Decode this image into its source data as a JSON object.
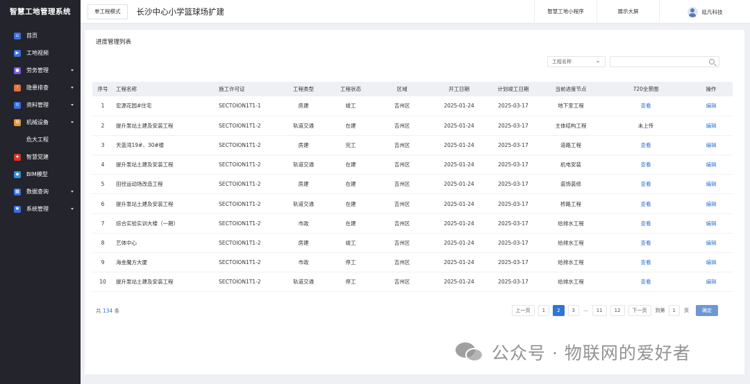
{
  "app": {
    "title": "智慧工地管理系统"
  },
  "sidebar": {
    "items": [
      {
        "label": "首页",
        "icon": "home-icon",
        "color": "#3b6fe0",
        "glyph": "⌂",
        "caret": false
      },
      {
        "label": "工地视频",
        "icon": "video-icon",
        "color": "#3b6fe0",
        "glyph": "▶",
        "caret": false
      },
      {
        "label": "劳务管理",
        "icon": "labor-icon",
        "color": "#7b5ce0",
        "glyph": "●",
        "caret": true
      },
      {
        "label": "隐患排查",
        "icon": "hazard-icon",
        "color": "#e0733b",
        "glyph": "!",
        "caret": true
      },
      {
        "label": "资料管理",
        "icon": "document-icon",
        "color": "#3b6fe0",
        "glyph": "≡",
        "caret": true
      },
      {
        "label": "机械设备",
        "icon": "machine-icon",
        "color": "#e09a3b",
        "glyph": "⚙",
        "caret": true
      },
      {
        "label": "危大工程",
        "icon": "",
        "color": "",
        "glyph": "",
        "caret": false,
        "sub": true
      },
      {
        "label": "智慧党建",
        "icon": "party-icon",
        "color": "#d9342b",
        "glyph": "★",
        "caret": false
      },
      {
        "label": "BIM模型",
        "icon": "bim-icon",
        "color": "#2f8fe0",
        "glyph": "◆",
        "caret": false
      },
      {
        "label": "数据查询",
        "icon": "data-icon",
        "color": "#3b6fe0",
        "glyph": "▦",
        "caret": true
      },
      {
        "label": "系统管理",
        "icon": "system-icon",
        "color": "#3b6fe0",
        "glyph": "✱",
        "caret": true
      }
    ]
  },
  "header": {
    "mode_button": "单工程模式",
    "project_title": "长沙中心小学篮球场扩建",
    "links": [
      "智慧工地小程序",
      "展示大屏"
    ],
    "user": "延凡科技"
  },
  "main": {
    "title": "进度管理列表",
    "filter": {
      "select_placeholder": "工程名称",
      "search_value": ""
    },
    "columns": [
      "序号",
      "工程名称",
      "施工许可证",
      "工程类型",
      "工程状态",
      "区域",
      "开工日期",
      "计划竣工日期",
      "当前进度节点",
      "720全景图",
      "操作"
    ],
    "rows": [
      {
        "no": "1",
        "name": "宏源花园#住宅",
        "permit": "SECTOION1T1-1",
        "type": "房建",
        "status": "竣工",
        "region": "吉州区",
        "start": "2025-01-24",
        "end": "2025-03-17",
        "node": "地下室工程",
        "pano": "查看",
        "pano_link": true,
        "action": "编辑"
      },
      {
        "no": "2",
        "name": "提升泵站土建及安装工程",
        "permit": "SECTOION1T1-2",
        "type": "轨道交通",
        "status": "在建",
        "region": "吉州区",
        "start": "2025-01-24",
        "end": "2025-03-17",
        "node": "主体结构工程",
        "pano": "未上传",
        "pano_link": false,
        "action": "编辑"
      },
      {
        "no": "3",
        "name": "天蓝湾19#、30#楼",
        "permit": "SECTOION1T1-2",
        "type": "房建",
        "status": "完工",
        "region": "吉州区",
        "start": "2025-01-24",
        "end": "2025-03-17",
        "node": "道路工程",
        "pano": "查看",
        "pano_link": true,
        "action": "编辑"
      },
      {
        "no": "4",
        "name": "提升泵站土建及安装工程",
        "permit": "SECTOION1T1-2",
        "type": "轨道交通",
        "status": "在建",
        "region": "吉州区",
        "start": "2025-01-24",
        "end": "2025-03-17",
        "node": "机电安装",
        "pano": "查看",
        "pano_link": true,
        "action": "编辑"
      },
      {
        "no": "5",
        "name": "田径运动场改造工程",
        "permit": "SECTOION1T1-2",
        "type": "房建",
        "status": "在建",
        "region": "吉州区",
        "start": "2025-01-24",
        "end": "2025-03-17",
        "node": "装饰装修",
        "pano": "查看",
        "pano_link": true,
        "action": "编辑"
      },
      {
        "no": "6",
        "name": "提升泵站土建及安装工程",
        "permit": "SECTOION1T1-2",
        "type": "轨道交通",
        "status": "在建",
        "region": "吉州区",
        "start": "2025-01-24",
        "end": "2025-03-17",
        "node": "桥路工程",
        "pano": "查看",
        "pano_link": true,
        "action": "编辑"
      },
      {
        "no": "7",
        "name": "综合实验实训大楼（一期）",
        "permit": "SECTOION1T1-2",
        "type": "市政",
        "status": "在建",
        "region": "吉州区",
        "start": "2025-01-24",
        "end": "2025-03-17",
        "node": "给排水工程",
        "pano": "查看",
        "pano_link": true,
        "action": "编辑"
      },
      {
        "no": "8",
        "name": "艺体中心",
        "permit": "SECTOION1T1-2",
        "type": "房建",
        "status": "竣工",
        "region": "吉州区",
        "start": "2025-01-24",
        "end": "2025-03-17",
        "node": "给排水工程",
        "pano": "查看",
        "pano_link": true,
        "action": "编辑"
      },
      {
        "no": "9",
        "name": "海金魔方大厦",
        "permit": "SECTOION1T1-2",
        "type": "市政",
        "status": "停工",
        "region": "吉州区",
        "start": "2025-01-24",
        "end": "2025-03-17",
        "node": "给排水工程",
        "pano": "查看",
        "pano_link": true,
        "action": "编辑"
      },
      {
        "no": "10",
        "name": "提升泵站土建及安装工程",
        "permit": "SECTOION1T1-2",
        "type": "轨道交通",
        "status": "停工",
        "region": "吉州区",
        "start": "2025-01-24",
        "end": "2025-03-17",
        "node": "给排水工程",
        "pano": "查看",
        "pano_link": true,
        "action": "编辑"
      }
    ],
    "total": {
      "prefix": "共",
      "count": "134",
      "suffix": "条"
    },
    "pagination": {
      "prev": "上一页",
      "pages": [
        "1",
        "2",
        "3",
        "...",
        "11",
        "12"
      ],
      "active_page": "2",
      "next": "下一页",
      "goto_label": "到第",
      "goto_value": "1",
      "page_unit": "页",
      "confirm": "确定"
    }
  },
  "watermark": {
    "text": "公众号 · 物联网的爱好者"
  },
  "colors": {
    "sidebar_bg": "#23242c",
    "accent": "#2f76d6",
    "header_bg": "#ffffff",
    "table_header_bg": "#eef0f4"
  }
}
